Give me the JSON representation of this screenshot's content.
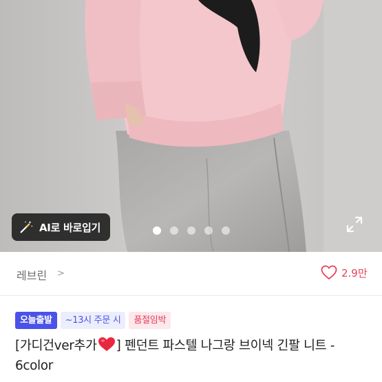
{
  "gallery": {
    "ai_button_label": "AI로 바로입기",
    "ai_icon": "magic-wand-icon",
    "expand_icon": "expand-icon",
    "slide_count": 5,
    "active_slide": 1
  },
  "shop": {
    "name": "레브린",
    "chevron": ">",
    "like_icon": "heart-outline-icon",
    "like_count": "2.9만"
  },
  "badges": {
    "today_shipping": "오늘출발",
    "order_deadline": "~13시 주문 시",
    "low_stock": "품절임박"
  },
  "product": {
    "title_prefix": "[가디건ver추가",
    "title_emoji": "heart-emoji-icon",
    "title_suffix": "] 펜던트 파스텔 나그랑  브이넥 긴팔 니트 - 6color"
  },
  "colors": {
    "accent_blue": "#4a52e8",
    "like_red": "#e8415b",
    "sold_red": "#e0405a"
  }
}
